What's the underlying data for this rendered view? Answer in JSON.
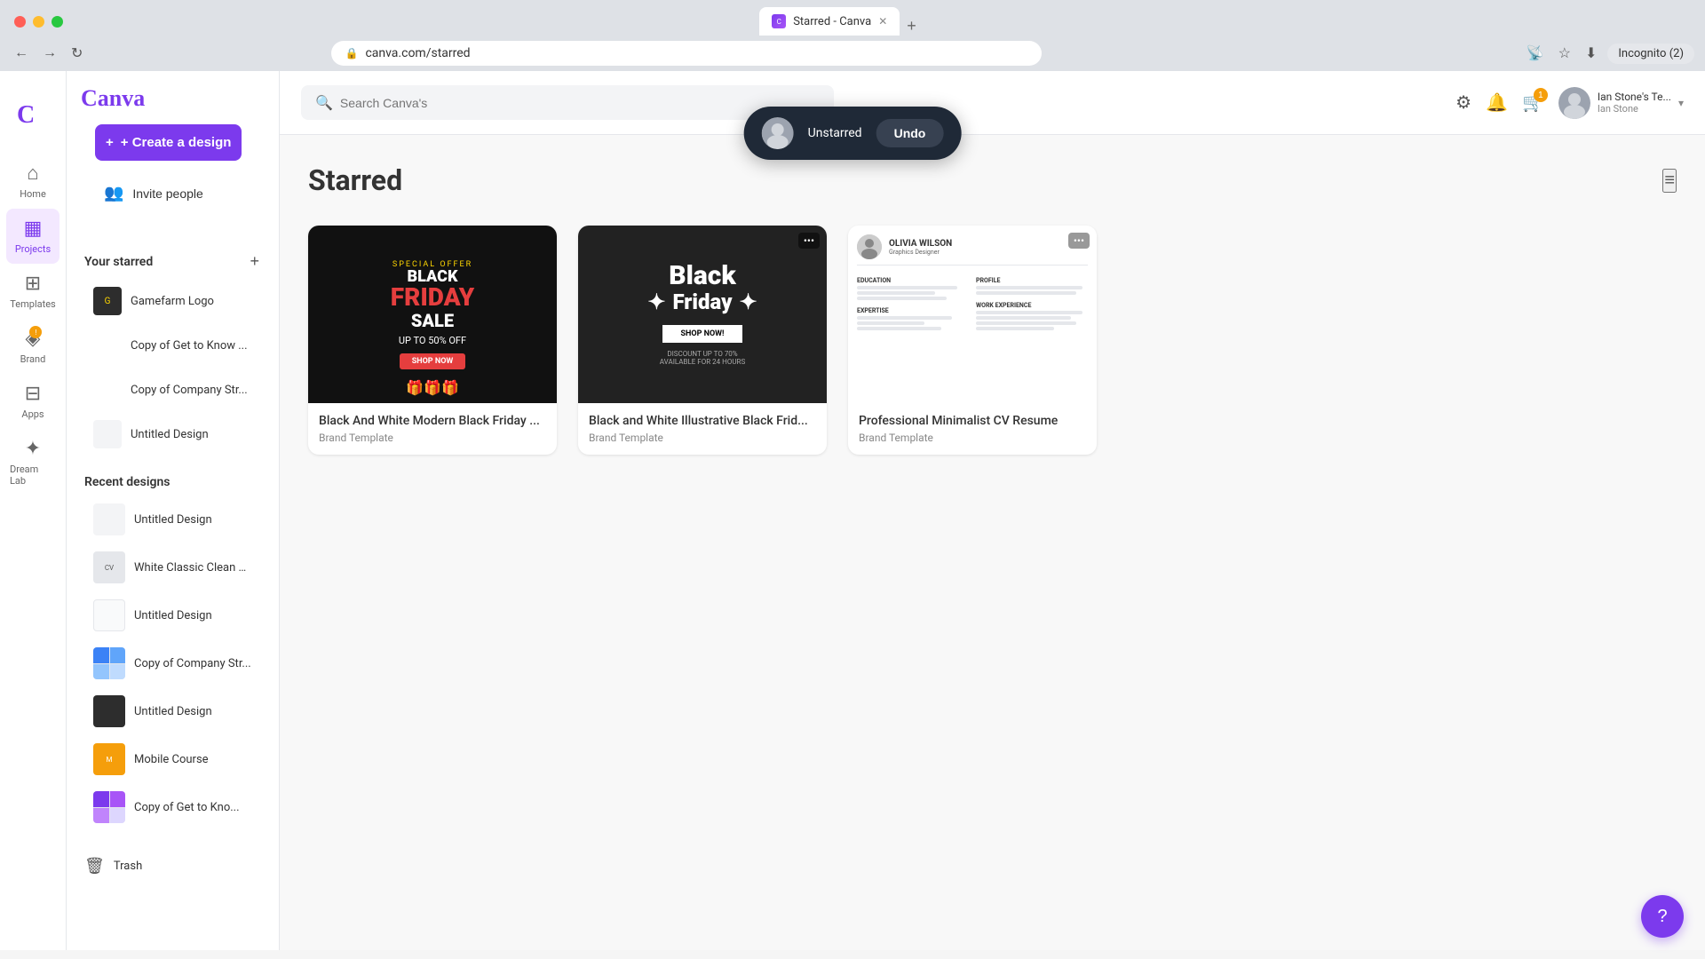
{
  "browser": {
    "tab_title": "Starred - Canva",
    "url": "canva.com/starred",
    "new_tab_tooltip": "New tab"
  },
  "header": {
    "search_placeholder": "Search Canva's",
    "settings_label": "Settings",
    "notifications_label": "Notifications",
    "cart_label": "Cart",
    "cart_badge": "1",
    "user_name": "Ian Stone's Te...",
    "user_sub": "Ian Stone"
  },
  "sidebar": {
    "logo": "Canva",
    "create_btn": "+ Create a design",
    "invite_btn": "Invite people",
    "nav_items": [
      {
        "id": "home",
        "label": "Home",
        "icon": "⌂"
      },
      {
        "id": "projects",
        "label": "Projects",
        "icon": "▦",
        "active": true
      },
      {
        "id": "templates",
        "label": "Templates",
        "icon": "⊞"
      },
      {
        "id": "brand",
        "label": "Brand",
        "icon": "◈"
      },
      {
        "id": "apps",
        "label": "Apps",
        "icon": "⊟"
      },
      {
        "id": "dreamlab",
        "label": "Dream Lab",
        "icon": "✦"
      }
    ],
    "starred_section_title": "Your starred",
    "starred_items": [
      {
        "id": "gamefarm-logo",
        "label": "Gamefarm Logo"
      },
      {
        "id": "copy-get-to-know",
        "label": "Copy of Get to Know ..."
      },
      {
        "id": "copy-company-str-1",
        "label": "Copy of Company Str..."
      },
      {
        "id": "untitled-design",
        "label": "Untitled Design"
      }
    ],
    "recent_section_title": "Recent designs",
    "recent_items": [
      {
        "id": "untitled-1",
        "label": "Untitled Design"
      },
      {
        "id": "white-classic",
        "label": "White Classic Clean R..."
      },
      {
        "id": "untitled-2",
        "label": "Untitled Design"
      },
      {
        "id": "copy-company-str-2",
        "label": "Copy of Company Str..."
      },
      {
        "id": "untitled-3",
        "label": "Untitled Design"
      },
      {
        "id": "mobile-course",
        "label": "Mobile Course"
      },
      {
        "id": "copy-get-to-know-2",
        "label": "Copy of Get to Kno..."
      }
    ],
    "trash_label": "Trash"
  },
  "main": {
    "page_title": "Starred",
    "view_toggle_icon": "≡",
    "cards": [
      {
        "id": "black-friday-1",
        "title": "Black And White Modern Black Friday ...",
        "subtitle": "Brand Template",
        "type": "black-friday-1"
      },
      {
        "id": "black-friday-2",
        "title": "Black and White Illustrative Black Frid...",
        "subtitle": "Brand Template",
        "type": "black-friday-2"
      },
      {
        "id": "cv-resume",
        "title": "Professional Minimalist CV Resume",
        "subtitle": "Brand Template",
        "type": "cv"
      }
    ]
  },
  "toast": {
    "text": "Unstarred",
    "undo_label": "Undo"
  },
  "help_btn": "?"
}
